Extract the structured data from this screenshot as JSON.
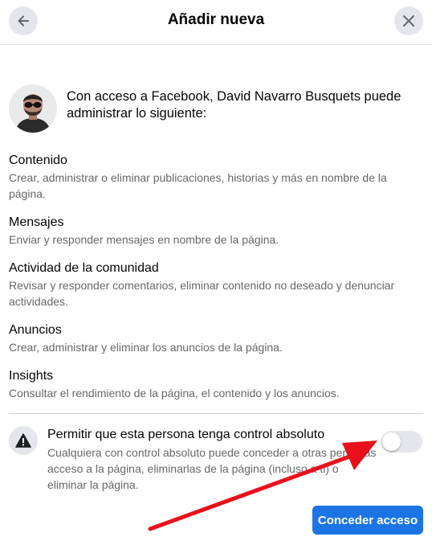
{
  "header": {
    "title": "Añadir nueva",
    "back_icon": "arrow-left-icon",
    "close_icon": "close-icon"
  },
  "intro": {
    "text": "Con acceso a Facebook, David Navarro Busquets puede administrar lo siguiente:"
  },
  "permissions": [
    {
      "title": "Contenido",
      "description": "Crear, administrar o eliminar publicaciones, historias y más en nombre de la página."
    },
    {
      "title": "Mensajes",
      "description": "Enviar y responder mensajes en nombre de la página."
    },
    {
      "title": "Actividad de la comunidad",
      "description": "Revisar y responder comentarios, eliminar contenido no deseado y denunciar actividades."
    },
    {
      "title": "Anuncios",
      "description": "Crear, administrar y eliminar los anuncios de la página."
    },
    {
      "title": "Insights",
      "description": "Consultar el rendimiento de la página, el contenido y los anuncios."
    }
  ],
  "full_control": {
    "title": "Permitir que esta persona tenga control absoluto",
    "description": "Cualquiera con control absoluto puede conceder a otras personas acceso a la página, eliminarlas de la página (incluso a ti) o eliminar la página.",
    "enabled": false,
    "icon": "warning-icon"
  },
  "actions": {
    "grant_label": "Conceder acceso"
  },
  "colors": {
    "primary": "#1b74e4",
    "annotation_arrow": "#e8101a",
    "secondary_text": "#65676b"
  }
}
